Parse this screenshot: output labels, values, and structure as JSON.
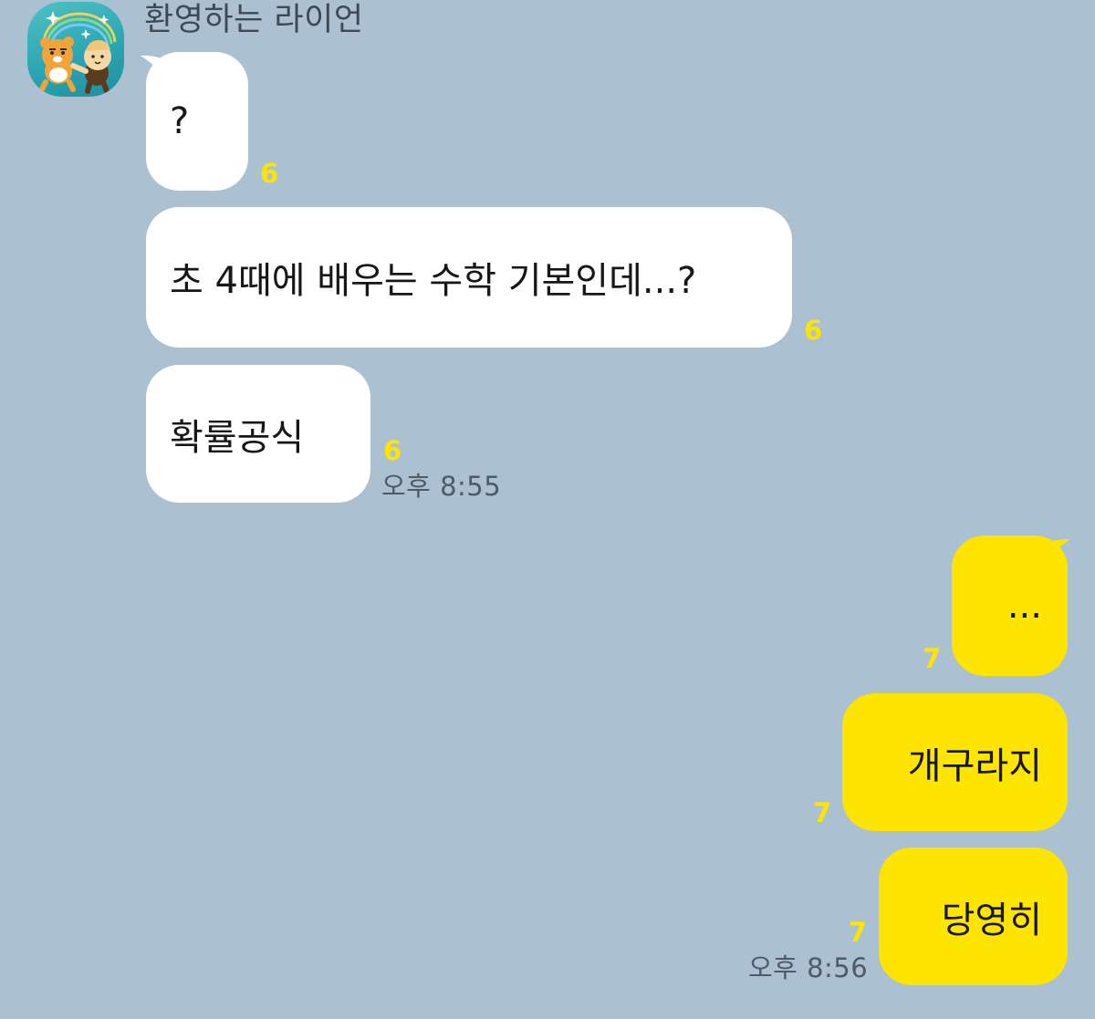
{
  "chat": {
    "sender_name": "환영하는 라이언",
    "incoming": [
      {
        "text": "?",
        "unread": "6"
      },
      {
        "text": "초 4때에 배우는 수학 기본인데...?",
        "unread": "6"
      },
      {
        "text": "확률공식",
        "unread": "6",
        "time": "오후 8:55"
      }
    ],
    "outgoing": [
      {
        "text": "...",
        "unread": "7"
      },
      {
        "text": "개구라지",
        "unread": "7"
      },
      {
        "text": "당영히",
        "unread": "7",
        "time": "오후 8:56"
      }
    ]
  },
  "icons": {
    "avatar": "ryan-character-avatar-icon"
  },
  "colors": {
    "chat_background": "#abc1d1",
    "incoming_bubble": "#ffffff",
    "outgoing_bubble": "#fee500",
    "unread_count": "#fee500",
    "timestamp": "#4e5a66"
  }
}
